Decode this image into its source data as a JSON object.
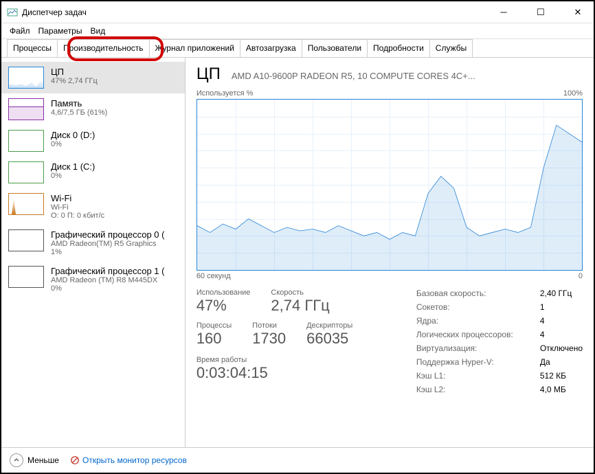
{
  "window": {
    "title": "Диспетчер задач"
  },
  "menu": {
    "file": "Файл",
    "options": "Параметры",
    "view": "Вид"
  },
  "tabs": [
    {
      "label": "Процессы"
    },
    {
      "label": "Производительность"
    },
    {
      "label": "Журнал приложений"
    },
    {
      "label": "Автозагрузка"
    },
    {
      "label": "Пользователи"
    },
    {
      "label": "Подробности"
    },
    {
      "label": "Службы"
    }
  ],
  "sidebar": [
    {
      "title": "ЦП",
      "line2": "47% 2,74 ГГц",
      "line3": "",
      "thumb": "cpu"
    },
    {
      "title": "Память",
      "line2": "4,6/7,5 ГБ (61%)",
      "line3": "",
      "thumb": "mem"
    },
    {
      "title": "Диск 0 (D:)",
      "line2": "0%",
      "line3": "",
      "thumb": "disk"
    },
    {
      "title": "Диск 1 (C:)",
      "line2": "0%",
      "line3": "",
      "thumb": "disk"
    },
    {
      "title": "Wi-Fi",
      "line2": "Wi-Fi",
      "line3": "О: 0 П: 0 кбит/с",
      "thumb": "wifi"
    },
    {
      "title": "Графический процессор 0 (",
      "line2": "AMD Radeon(TM) R5 Graphics",
      "line3": "1%",
      "thumb": "gpu"
    },
    {
      "title": "Графический процессор 1 (",
      "line2": "AMD Radeon (TM) R8 M445DX",
      "line3": "0%",
      "thumb": "gpu"
    }
  ],
  "main": {
    "title": "ЦП",
    "subtitle": "AMD A10-9600P RADEON R5, 10 COMPUTE CORES 4C+...",
    "chart_top_left": "Используется %",
    "chart_top_right": "100%",
    "chart_bottom_left": "60 секунд",
    "chart_bottom_right": "0",
    "stats": {
      "usage_label": "Использование",
      "usage_value": "47%",
      "speed_label": "Скорость",
      "speed_value": "2,74 ГГц",
      "processes_label": "Процессы",
      "processes_value": "160",
      "threads_label": "Потоки",
      "threads_value": "1730",
      "handles_label": "Дескрипторы",
      "handles_value": "66035",
      "uptime_label": "Время работы",
      "uptime_value": "0:03:04:15"
    },
    "right": [
      {
        "label": "Базовая скорость:",
        "value": "2,40 ГГц"
      },
      {
        "label": "Сокетов:",
        "value": "1"
      },
      {
        "label": "Ядра:",
        "value": "4"
      },
      {
        "label": "Логических процессоров:",
        "value": "4"
      },
      {
        "label": "Виртуализация:",
        "value": "Отключено"
      },
      {
        "label": "Поддержка Hyper-V:",
        "value": "Да"
      },
      {
        "label": "Кэш L1:",
        "value": "512 КБ"
      },
      {
        "label": "Кэш L2:",
        "value": "4,0 МБ"
      }
    ]
  },
  "footer": {
    "fewer": "Меньше",
    "resmon": "Открыть монитор ресурсов"
  },
  "chart_data": {
    "type": "line",
    "title": "Используется %",
    "xlabel": "60 секунд → 0",
    "ylabel": "%",
    "ylim": [
      0,
      100
    ],
    "x": [
      0,
      2,
      4,
      6,
      8,
      10,
      12,
      14,
      16,
      18,
      20,
      22,
      24,
      26,
      28,
      30,
      32,
      34,
      36,
      38,
      40,
      42,
      44,
      46,
      48,
      50,
      52,
      54,
      56,
      58,
      60
    ],
    "values": [
      26,
      22,
      27,
      24,
      30,
      26,
      22,
      25,
      23,
      24,
      22,
      26,
      23,
      20,
      22,
      18,
      22,
      20,
      45,
      55,
      48,
      25,
      20,
      22,
      24,
      22,
      25,
      60,
      85,
      80,
      75
    ]
  },
  "colors": {
    "cpu": "#2783d7",
    "memory": "#8a2da8",
    "disk": "#4a9e4a",
    "wifi": "#c97a1f",
    "gpu": "#555555",
    "highlight": "#d10000",
    "link": "#0066cc"
  }
}
